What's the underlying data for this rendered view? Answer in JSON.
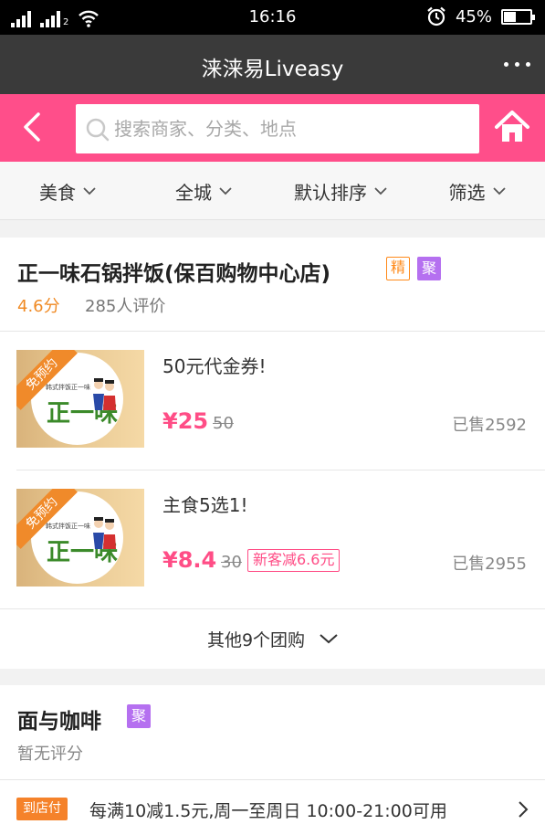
{
  "status_bar": {
    "time": "16:16",
    "battery_text": "45%",
    "battery_level": 0.45,
    "sim2_label": "2"
  },
  "app": {
    "title": "涞涞易Liveasy"
  },
  "search": {
    "placeholder": "搜索商家、分类、地点"
  },
  "filters": [
    {
      "label": "美食"
    },
    {
      "label": "全城"
    },
    {
      "label": "默认排序"
    },
    {
      "label": "筛选"
    }
  ],
  "shops": [
    {
      "name": "正一味石锅拌饭(保百购物中心店)",
      "badges": [
        "精",
        "聚"
      ],
      "score": "4.6分",
      "reviews": "285人评价",
      "deals": [
        {
          "title": "50元代金券!",
          "price": "¥25",
          "original_price": "50",
          "promo": "",
          "sold": "已售2592",
          "corner_badge": "免预约",
          "image_small_text": "韩式拌饭正一味",
          "image_logo": "正一味"
        },
        {
          "title": "主食5选1!",
          "price": "¥8.4",
          "original_price": "30",
          "promo": "新客减6.6元",
          "sold": "已售2955",
          "corner_badge": "免预约",
          "image_small_text": "韩式拌饭正一味",
          "image_logo": "正一味"
        }
      ],
      "more_deals": "其他9个团购"
    },
    {
      "name": "面与咖啡",
      "badges": [
        "聚"
      ],
      "score": "暂无评分",
      "pay_tag": "到店付",
      "pay_text": "每满10减1.5元,周一至周日 10:00-21:00可用"
    }
  ],
  "colors": {
    "accent": "#ff4e8a",
    "title_bar": "#3a3a3a",
    "score": "#f08a24",
    "badge_purple": "#b570f0",
    "badge_orange": "#ff8a1a"
  }
}
